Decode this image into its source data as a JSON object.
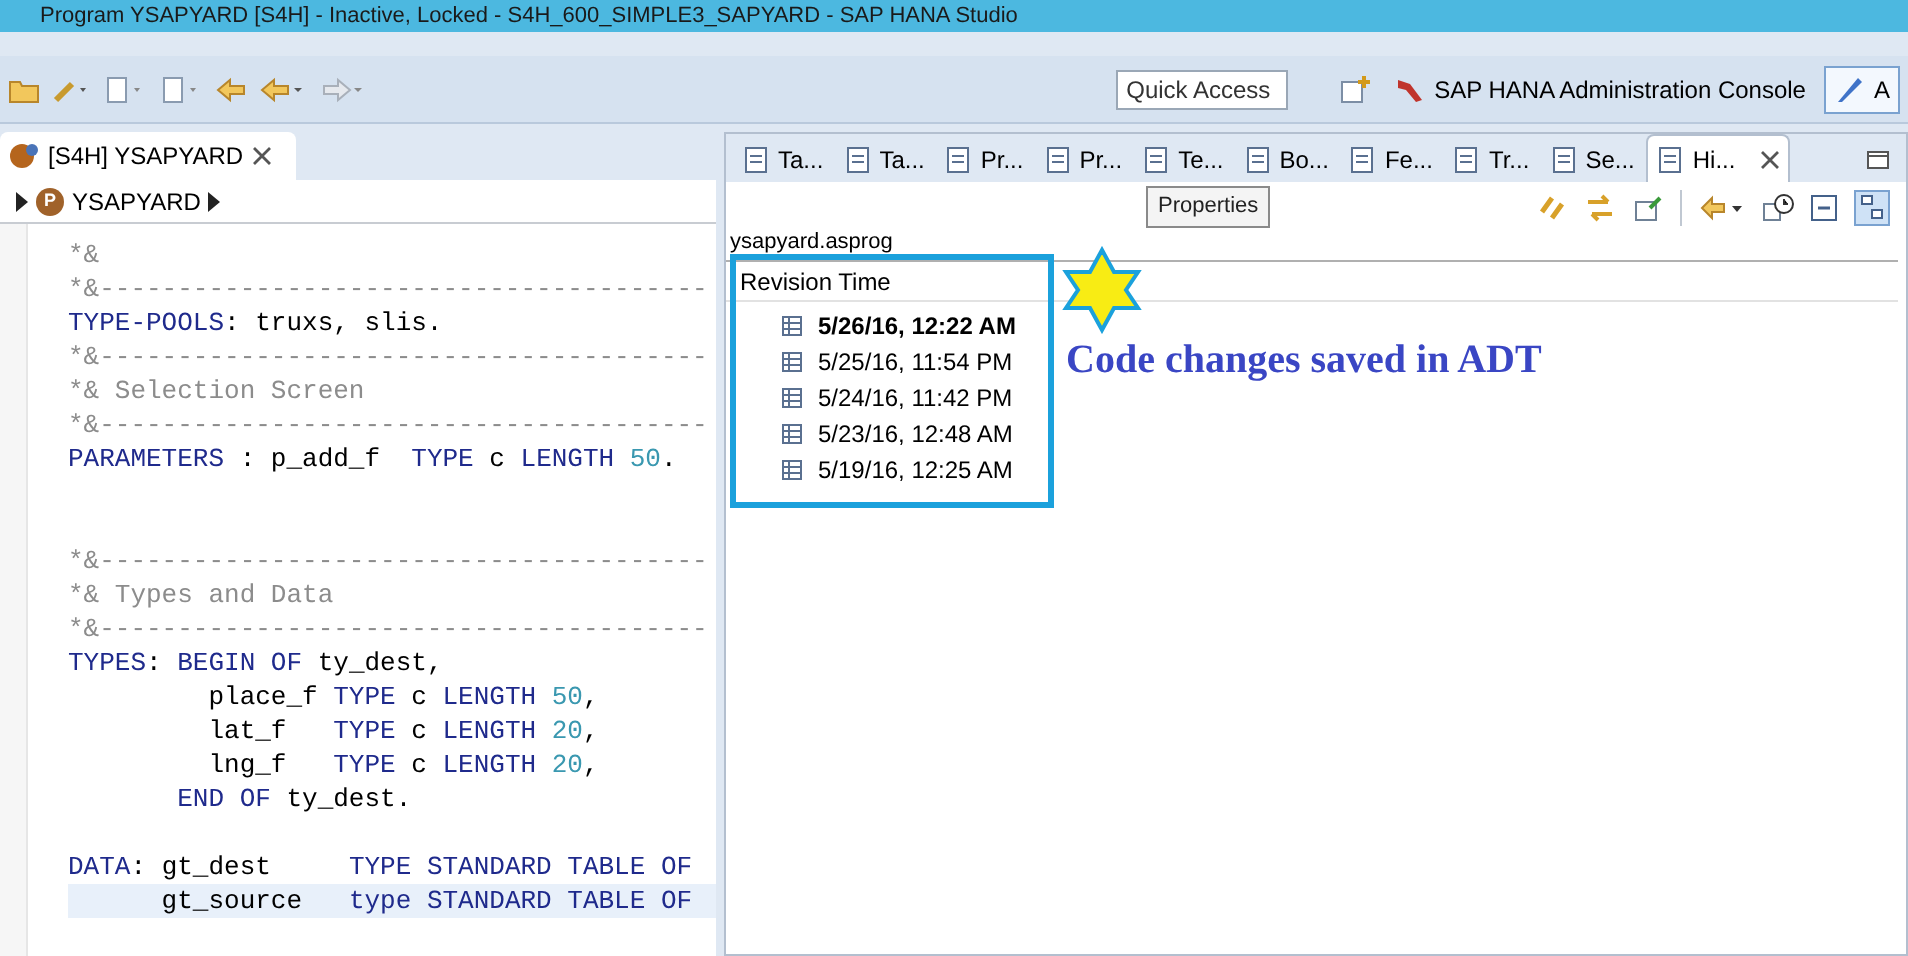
{
  "window": {
    "title": "Program YSAPYARD [S4H] - Inactive, Locked - S4H_600_SIMPLE3_SAPYARD - SAP HANA Studio"
  },
  "toolbar": {
    "quick_access": {
      "placeholder": "Quick Access"
    },
    "perspectives": [
      {
        "label": "SAP HANA Administration Console",
        "selected": false
      },
      {
        "label": "A",
        "selected": true
      }
    ]
  },
  "editor": {
    "tab": {
      "label": "[S4H] YSAPYARD"
    },
    "breadcrumb_badge": "P",
    "breadcrumb": "YSAPYARD",
    "lines": [
      {
        "highlighted": false,
        "tokens": [
          {
            "kind": "comment",
            "text": "*&"
          }
        ]
      },
      {
        "highlighted": false,
        "tokens": [
          {
            "kind": "comment",
            "text": "*&---------------------------------------"
          }
        ]
      },
      {
        "highlighted": false,
        "tokens": [
          {
            "kind": "keyword",
            "text": "TYPE-POOLS"
          },
          {
            "kind": "plain",
            "text": ": truxs, slis."
          }
        ]
      },
      {
        "highlighted": false,
        "tokens": [
          {
            "kind": "comment",
            "text": "*&---------------------------------------"
          }
        ]
      },
      {
        "highlighted": false,
        "tokens": [
          {
            "kind": "comment",
            "text": "*& Selection Screen"
          }
        ]
      },
      {
        "highlighted": false,
        "tokens": [
          {
            "kind": "comment",
            "text": "*&---------------------------------------"
          }
        ]
      },
      {
        "highlighted": false,
        "tokens": [
          {
            "kind": "keyword",
            "text": "PARAMETERS"
          },
          {
            "kind": "plain",
            "text": " : p_add_f  "
          },
          {
            "kind": "keyword",
            "text": "TYPE"
          },
          {
            "kind": "plain",
            "text": " c "
          },
          {
            "kind": "keyword",
            "text": "LENGTH "
          },
          {
            "kind": "number",
            "text": "50"
          },
          {
            "kind": "plain",
            "text": "."
          }
        ]
      },
      {
        "highlighted": false
      },
      {
        "highlighted": false
      },
      {
        "highlighted": false,
        "tokens": [
          {
            "kind": "comment",
            "text": "*&---------------------------------------"
          }
        ]
      },
      {
        "highlighted": false,
        "tokens": [
          {
            "kind": "comment",
            "text": "*& Types and Data"
          }
        ]
      },
      {
        "highlighted": false,
        "tokens": [
          {
            "kind": "comment",
            "text": "*&---------------------------------------"
          }
        ]
      },
      {
        "highlighted": false,
        "tokens": [
          {
            "kind": "keyword",
            "text": "TYPES"
          },
          {
            "kind": "plain",
            "text": ": "
          },
          {
            "kind": "keyword",
            "text": "BEGIN OF"
          },
          {
            "kind": "plain",
            "text": " ty_dest,"
          }
        ]
      },
      {
        "highlighted": false,
        "tokens": [
          {
            "kind": "plain",
            "text": "         place_f "
          },
          {
            "kind": "keyword",
            "text": "TYPE"
          },
          {
            "kind": "plain",
            "text": " c "
          },
          {
            "kind": "keyword",
            "text": "LENGTH "
          },
          {
            "kind": "number",
            "text": "50"
          },
          {
            "kind": "plain",
            "text": ","
          }
        ]
      },
      {
        "highlighted": false,
        "tokens": [
          {
            "kind": "plain",
            "text": "         lat_f   "
          },
          {
            "kind": "keyword",
            "text": "TYPE"
          },
          {
            "kind": "plain",
            "text": " c "
          },
          {
            "kind": "keyword",
            "text": "LENGTH "
          },
          {
            "kind": "number",
            "text": "20"
          },
          {
            "kind": "plain",
            "text": ","
          }
        ]
      },
      {
        "highlighted": false,
        "tokens": [
          {
            "kind": "plain",
            "text": "         lng_f   "
          },
          {
            "kind": "keyword",
            "text": "TYPE"
          },
          {
            "kind": "plain",
            "text": " c "
          },
          {
            "kind": "keyword",
            "text": "LENGTH "
          },
          {
            "kind": "number",
            "text": "20"
          },
          {
            "kind": "plain",
            "text": ","
          }
        ]
      },
      {
        "highlighted": false,
        "tokens": [
          {
            "kind": "keyword",
            "text": "       END OF"
          },
          {
            "kind": "plain",
            "text": " ty_dest."
          }
        ]
      },
      {
        "highlighted": false
      },
      {
        "highlighted": false,
        "tokens": [
          {
            "kind": "keyword",
            "text": "DATA"
          },
          {
            "kind": "plain",
            "text": ": gt_dest     "
          },
          {
            "kind": "keyword",
            "text": "TYPE STANDARD TABLE OF"
          }
        ]
      },
      {
        "highlighted": true,
        "tokens": [
          {
            "kind": "plain",
            "text": "      gt_source   "
          },
          {
            "kind": "keyword",
            "text": "type STANDARD TABLE OF"
          }
        ]
      }
    ]
  },
  "history_view": {
    "tabs": [
      {
        "label": "Ta...",
        "selected": false
      },
      {
        "label": "Ta...",
        "selected": false
      },
      {
        "label": "Pr...",
        "selected": false
      },
      {
        "label": "Pr...",
        "selected": false
      },
      {
        "label": "Te...",
        "selected": false
      },
      {
        "label": "Bo...",
        "selected": false
      },
      {
        "label": "Fe...",
        "selected": false
      },
      {
        "label": "Tr...",
        "selected": false
      },
      {
        "label": "Se...",
        "selected": false
      },
      {
        "label": "Hi...",
        "selected": true
      }
    ],
    "tooltip": "Properties",
    "resource": "ysapyard.asprog",
    "column": "Revision Time",
    "revisions": [
      {
        "time": "5/26/16, 12:22 AM",
        "current": true
      },
      {
        "time": "5/25/16, 11:54 PM",
        "current": false
      },
      {
        "time": "5/24/16, 11:42 PM",
        "current": false
      },
      {
        "time": "5/23/16, 12:48 AM",
        "current": false
      },
      {
        "time": "5/19/16, 12:25 AM",
        "current": false
      }
    ],
    "annotation": "Code changes saved in ADT"
  }
}
